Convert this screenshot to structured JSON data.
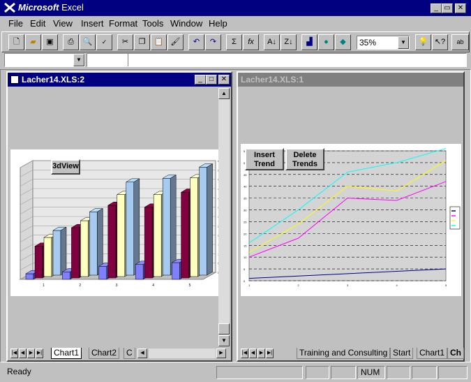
{
  "app": {
    "brand": "Microsoft",
    "name": "Excel"
  },
  "menu": [
    "File",
    "Edit",
    "View",
    "Insert",
    "Format",
    "Tools",
    "Window",
    "Help"
  ],
  "toolbar": {
    "zoom": "35%",
    "sum_label": "Σ",
    "fx_label": "fx",
    "ab_label": "ab"
  },
  "left_window": {
    "title": "Lacher14.XLS:2",
    "button_3dview": "3dView",
    "tabs": [
      "Chart1",
      "Chart2",
      "C"
    ]
  },
  "right_window": {
    "title": "Lacher14.XLS:1",
    "button_insert_trend": "Insert Trend",
    "button_delete_trends": "Delete Trends",
    "tabs": [
      "Training and Consulting",
      "Start",
      "Chart1",
      "Ch"
    ]
  },
  "status": {
    "ready": "Ready",
    "num": "NUM"
  },
  "chart_data": [
    {
      "type": "bar",
      "categories": [
        "1",
        "2",
        "3",
        "4",
        "5"
      ],
      "series": [
        {
          "values": [
            3,
            4,
            7,
            8,
            9
          ],
          "color": "#8080ff"
        },
        {
          "values": [
            17,
            27,
            39,
            38,
            46
          ],
          "color": "#800040"
        },
        {
          "values": [
            21,
            30,
            44,
            44,
            53
          ],
          "color": "#ffffc0"
        },
        {
          "values": [
            24,
            34,
            50,
            52,
            58
          ],
          "color": "#a6caf0"
        }
      ],
      "ylim": [
        0,
        60
      ]
    },
    {
      "type": "line",
      "x": [
        "1",
        "2",
        "3",
        "4",
        "5"
      ],
      "series": [
        {
          "values": [
            1,
            2,
            3,
            4,
            5
          ],
          "color": "#000080"
        },
        {
          "values": [
            10,
            18,
            35,
            34,
            42
          ],
          "color": "#ff00ff"
        },
        {
          "values": [
            12,
            24,
            40,
            38,
            51
          ],
          "color": "#ffff00"
        },
        {
          "values": [
            16,
            30,
            46,
            50,
            56
          ],
          "color": "#00ffff"
        }
      ],
      "ylim": [
        0,
        55
      ],
      "yticks": [
        "0",
        "5",
        "10",
        "15",
        "20",
        "25",
        "30",
        "35",
        "40",
        "45",
        "50",
        "55"
      ]
    }
  ]
}
